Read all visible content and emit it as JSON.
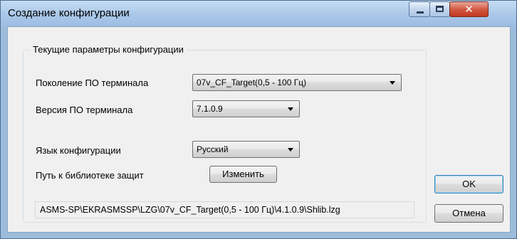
{
  "window": {
    "title": "Создание конфигурации"
  },
  "group": {
    "legend": "Текущие параметры конфигурации",
    "generation_label": "Поколение ПО терминала",
    "generation_value": "07v_CF_Target(0,5 - 100 Гц)",
    "version_label": "Версия ПО терминала",
    "version_value": "7.1.0.9",
    "language_label": "Язык конфигурации",
    "language_value": "Русский",
    "library_label": "Путь к библиотеке защит",
    "change_button": "Изменить",
    "library_path": "ASMS-SP\\EKRASMSSP\\LZG\\07v_CF_Target(0,5 - 100 Гц)\\4.1.0.9\\Shlib.lzg"
  },
  "buttons": {
    "ok": "OK",
    "cancel": "Отмена"
  },
  "titlebar_icons": [
    "minimize-icon",
    "maximize-icon",
    "close-icon"
  ]
}
